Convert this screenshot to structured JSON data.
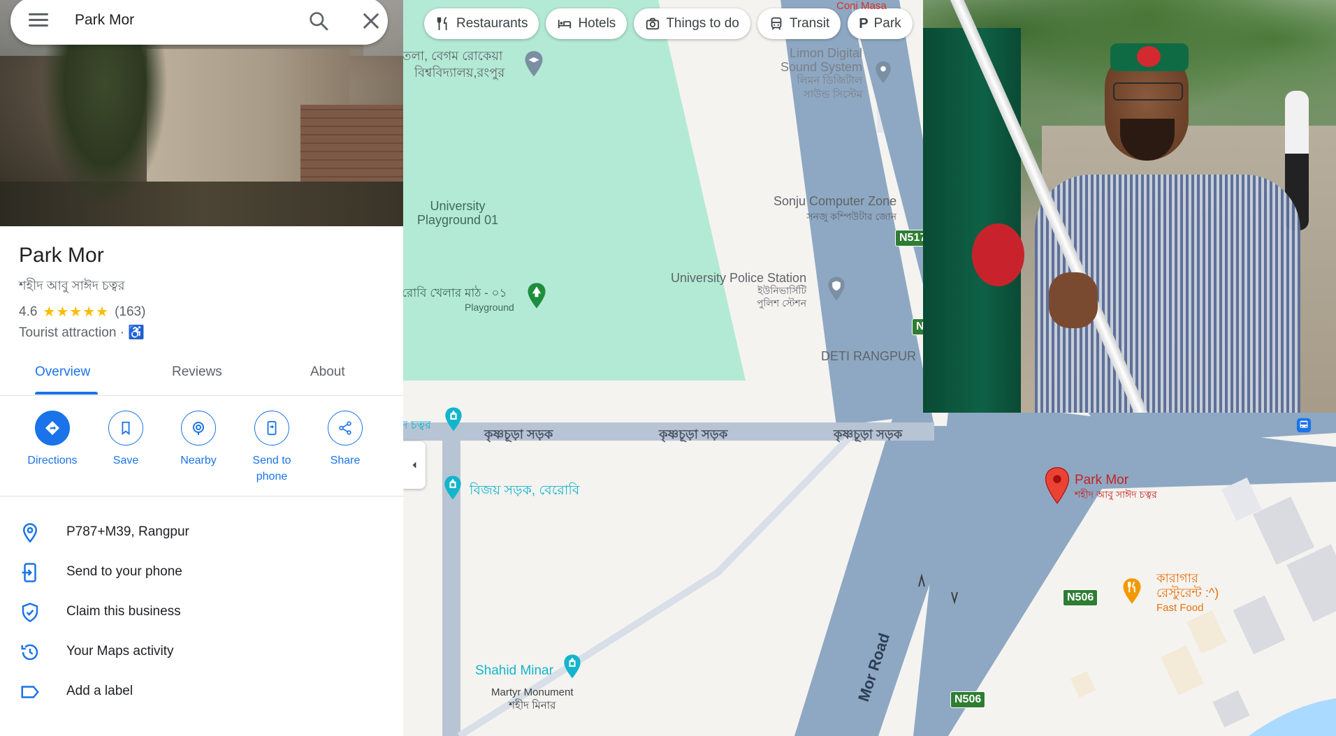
{
  "search": {
    "value": "Park Mor"
  },
  "place": {
    "title": "Park Mor",
    "subtitle": "শহীদ আবু সাঈদ চত্বর",
    "rating": "4.6",
    "stars": "★★★★★",
    "reviews_count": "(163)",
    "category": "Tourist attraction",
    "separator": "·",
    "accessibility_symbol": "♿"
  },
  "tabs": [
    {
      "label": "Overview",
      "active": true
    },
    {
      "label": "Reviews",
      "active": false
    },
    {
      "label": "About",
      "active": false
    }
  ],
  "actions": [
    {
      "label": "Directions",
      "icon": "directions-icon"
    },
    {
      "label": "Save",
      "icon": "bookmark-icon"
    },
    {
      "label": "Nearby",
      "icon": "nearby-icon"
    },
    {
      "label": "Send to phone",
      "icon": "send-to-phone-icon"
    },
    {
      "label": "Share",
      "icon": "share-icon"
    }
  ],
  "info_rows": [
    {
      "text": "P787+M39, Rangpur",
      "icon": "location-pin-icon"
    },
    {
      "text": "Send to your phone",
      "icon": "send-to-phone-icon"
    },
    {
      "text": "Claim this business",
      "icon": "shield-check-icon"
    },
    {
      "text": "Your Maps activity",
      "icon": "history-icon"
    },
    {
      "text": "Add a label",
      "icon": "label-icon"
    }
  ],
  "chips": [
    {
      "label": "Restaurants",
      "icon": "restaurant-icon"
    },
    {
      "label": "Hotels",
      "icon": "hotel-icon"
    },
    {
      "label": "Things to do",
      "icon": "camera-icon"
    },
    {
      "label": "Transit",
      "icon": "transit-icon"
    },
    {
      "label": "Park",
      "icon": "parking-icon"
    }
  ],
  "map": {
    "labels": {
      "begum_rokeya": "তলা, বেগম রোকেয়া",
      "university_rangpur": "বিশ্ববিদ্যালয়,রংপুর",
      "limon_digital_1": "Limon Digital",
      "limon_digital_2": "Sound System",
      "limon_bn_1": "লিমন ডিজিটাল",
      "limon_bn_2": "সাউন্ড সিস্টেম",
      "coni": "Coni Masa",
      "university_playground_1": "University",
      "university_playground_2": "Playground 01",
      "sonju": "Sonju Computer Zone",
      "sonju_bn": "সনজু কম্পিউটার জোন",
      "playground_bn": "রোবি খেলার মাঠ - ০১",
      "playground": "Playground",
      "police_station": "University Police Station",
      "police_bn_1": "ইউনিভার্সিটি",
      "police_bn_2": "পুলিশ স্টেশন",
      "deti": "DETI RANGPUR",
      "chattar": "দ চত্বর",
      "road_1": "কৃষ্ণচূড়া সড়ক",
      "road_2": "কৃষ্ণচূড়া সড়ক",
      "road_3": "কৃষ্ণচূড়া সড়ক",
      "bijoy": "বিজয় সড়ক, বেরোবি",
      "shahid_minar": "Shahid Minar",
      "martyr_monument": "Martyr Monument",
      "shahid_minar_bn": "শহীদ মিনার",
      "park_mor": "Park Mor",
      "park_mor_bn": "শহীদ আবু সাঈদ চত্বর",
      "karagar_1": "কারাগার",
      "karagar_2": "রেস্টুরেন্ট :^)",
      "fast_food": "Fast Food",
      "mor_road": "Mor Road",
      "n517": "N517",
      "n_short": "N",
      "n506_a": "N506",
      "n506_b": "N506"
    },
    "colors": {
      "park_green": "#b3ead6",
      "road_blue": "#8ea8c3",
      "road_light": "#b7c4d4",
      "pin_red": "#ea4335",
      "poi_teal": "#12b5cb",
      "route_badge": "#2e7d32",
      "accent": "#1a73e8"
    }
  }
}
